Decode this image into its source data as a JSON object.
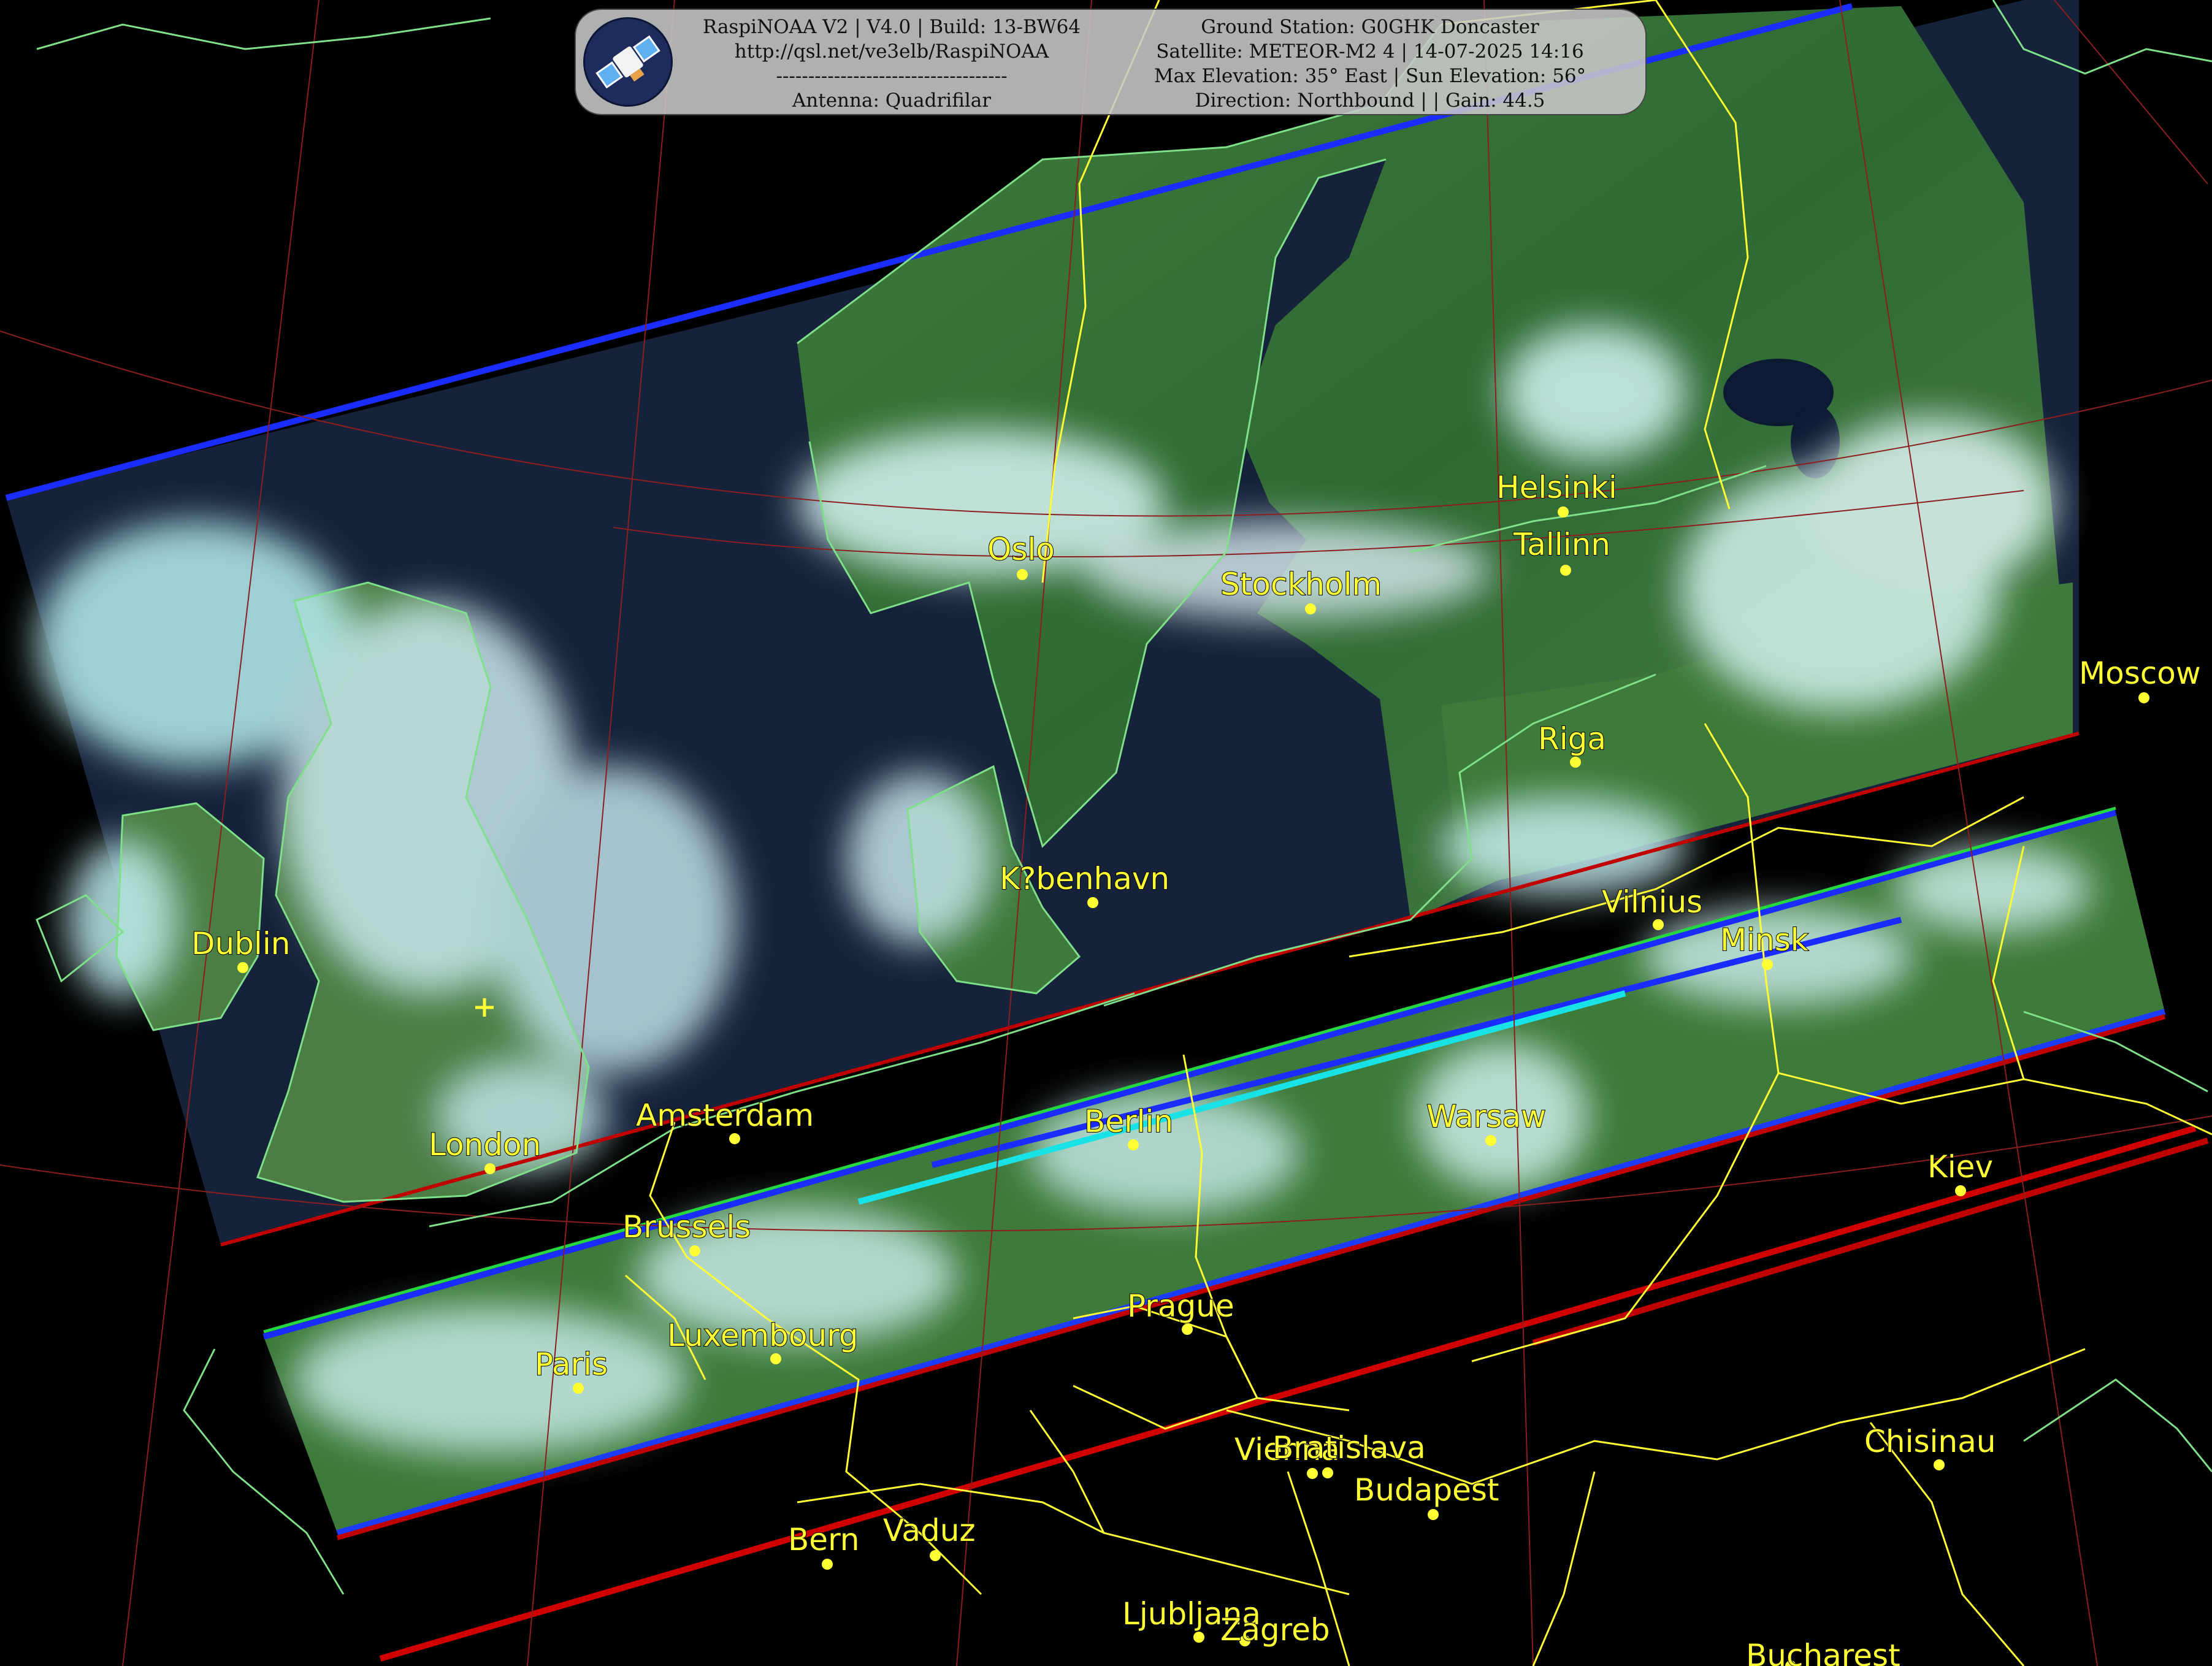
{
  "header": {
    "app_line": "RaspiNOAA V2 | V4.0 | Build: 13-BW64",
    "url_line": "http://qsl.net/ve3elb/RaspiNOAA",
    "separator_line": "------------------------------------",
    "antenna_line": "Antenna: Quadrifilar",
    "station_line": "Ground Station: G0GHK Doncaster",
    "satellite_line": "Satellite: METEOR-M2 4 | 14-07-2025 14:16",
    "elevation_line": "Max Elevation: 35° East | Sun Elevation: 56°",
    "direction_line": "Direction: Northbound | | Gain: 44.5",
    "logo_icon": "satellite-icon"
  },
  "map": {
    "colors": {
      "background": "#000000",
      "coastline": "#7fe08a",
      "borders": "#ffff33",
      "graticule": "#8b1f1f",
      "city_labels": "#ffff33"
    },
    "cities": [
      {
        "id": "oslo",
        "name": "Oslo"
      },
      {
        "id": "stockholm",
        "name": "Stockholm"
      },
      {
        "id": "helsinki",
        "name": "Helsinki"
      },
      {
        "id": "tallinn",
        "name": "Tallinn"
      },
      {
        "id": "riga",
        "name": "Riga"
      },
      {
        "id": "moscow",
        "name": "Moscow"
      },
      {
        "id": "dublin",
        "name": "Dublin"
      },
      {
        "id": "kobenhavn",
        "name": "K?benhavn"
      },
      {
        "id": "vilnius",
        "name": "Vilnius"
      },
      {
        "id": "minsk",
        "name": "Minsk"
      },
      {
        "id": "amsterdam",
        "name": "Amsterdam"
      },
      {
        "id": "london",
        "name": "London"
      },
      {
        "id": "berlin",
        "name": "Berlin"
      },
      {
        "id": "warsaw",
        "name": "Warsaw"
      },
      {
        "id": "kiev",
        "name": "Kiev"
      },
      {
        "id": "brussels",
        "name": "Brussels"
      },
      {
        "id": "prague",
        "name": "Prague"
      },
      {
        "id": "luxembourg",
        "name": "Luxembourg"
      },
      {
        "id": "paris",
        "name": "Paris"
      },
      {
        "id": "vienna",
        "name": "Vienna"
      },
      {
        "id": "bratislava",
        "name": "Bratislava"
      },
      {
        "id": "budapest",
        "name": "Budapest"
      },
      {
        "id": "chisinau",
        "name": "Chisinau"
      },
      {
        "id": "bern",
        "name": "Bern"
      },
      {
        "id": "vaduz",
        "name": "Vaduz"
      },
      {
        "id": "ljubljana",
        "name": "Ljubljana"
      },
      {
        "id": "zagreb",
        "name": "Zagreb"
      },
      {
        "id": "bucharest",
        "name": "Bucharest"
      }
    ]
  }
}
